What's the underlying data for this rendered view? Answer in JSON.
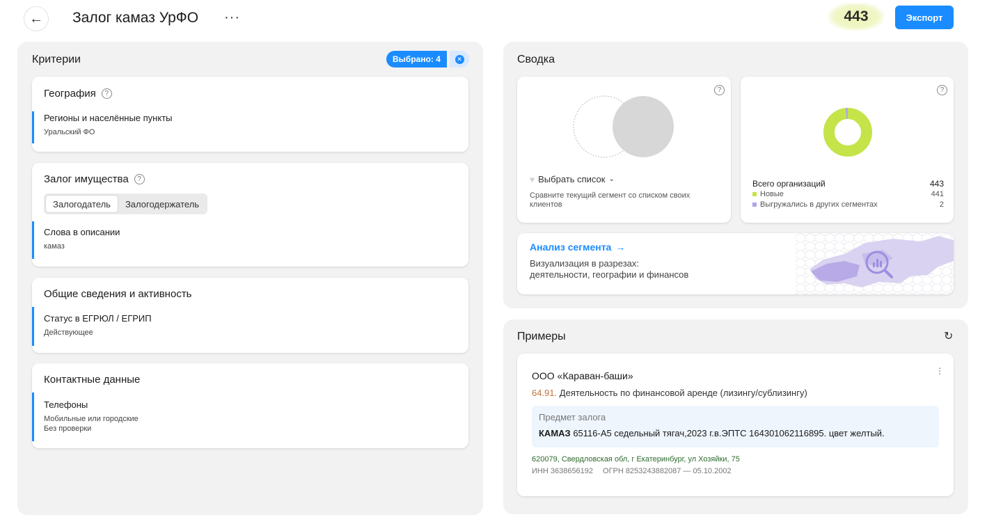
{
  "header": {
    "back_icon": "arrow-left-icon",
    "title": "Залог камаз УрФО",
    "more": "···",
    "count": "443",
    "export_label": "Экспорт"
  },
  "criteria": {
    "title": "Критерии",
    "selected_label": "Выбрано: 4",
    "sections": [
      {
        "title": "География",
        "items": [
          {
            "label": "Регионы и населённые пункты",
            "value": "Уральский ФО"
          }
        ]
      },
      {
        "title": "Залог имущества",
        "toggle": [
          "Залогодатель",
          "Залогодержатель"
        ],
        "toggle_selected": "Залогодатель",
        "items": [
          {
            "label": "Слова в описании",
            "value": "камаз"
          }
        ]
      },
      {
        "title": "Общие сведения и активность",
        "items": [
          {
            "label": "Статус в ЕГРЮЛ / ЕГРИП",
            "value": "Действующее"
          }
        ]
      },
      {
        "title": "Контактные данные",
        "items": [
          {
            "label": "Телефоны",
            "value_lines": [
              "Мобильные или городские",
              "Без проверки"
            ]
          }
        ]
      }
    ]
  },
  "summary": {
    "title": "Сводка",
    "compare": {
      "select_label": "Выбрать список",
      "description": "Сравните текущий сегмент со списком своих клиентов"
    },
    "totals": {
      "total_label": "Всего организаций",
      "total_value": "443",
      "legend": [
        {
          "label": "Новые",
          "value": "441",
          "color": "#c4e44a"
        },
        {
          "label": "Выгружались в других сегментах",
          "value": "2",
          "color": "#b3a4e8"
        }
      ]
    },
    "analysis": {
      "title": "Анализ сегмента",
      "arrow": "→",
      "description_lines": [
        "Визуализация в разрезах:",
        "деятельности, географии и финансов"
      ]
    }
  },
  "examples": {
    "title": "Примеры",
    "refresh_icon": "refresh-icon",
    "card": {
      "company": "ООО «Караван-баши»",
      "okved_code": "64.91.",
      "okved_text": "Деятельность по финансовой аренде (лизингу/сублизингу)",
      "pledge_title": "Предмет залога",
      "pledge_bold": "КАМАЗ",
      "pledge_text": "65116-А5 седельный тягач,2023 г.в.ЭПТС 164301062116895. цвет желтый.",
      "address": "620079, Свердловская обл, г Екатеринбург, ул Хозяйки, 75",
      "inn": "ИНН 3638656192",
      "ogrn": "ОГРН 8253243882087 — 05.10.2002"
    }
  },
  "colors": {
    "accent": "#1a8cff",
    "donut_main": "#c4e44a",
    "donut_other": "#b3a4e8"
  }
}
